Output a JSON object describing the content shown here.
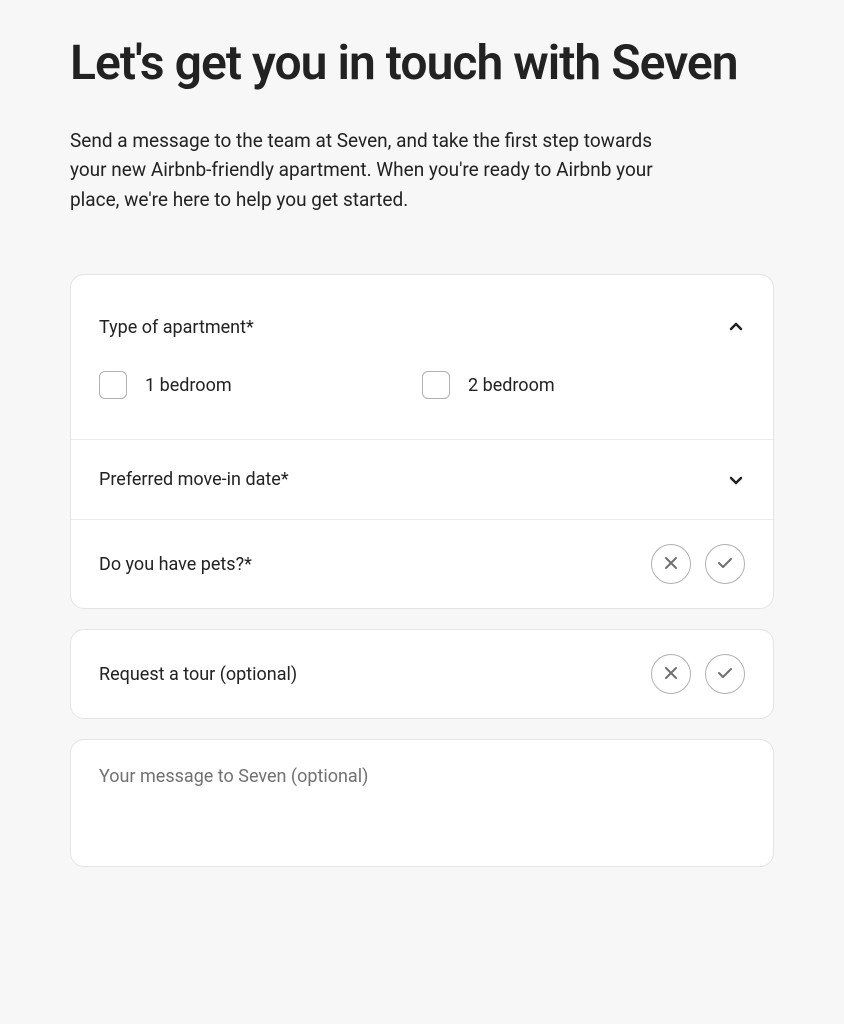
{
  "header": {
    "title": "Let's get you in touch with Seven",
    "intro": "Send a message to the team at Seven, and take the first step towards your new Airbnb-friendly apartment. When you're ready to Airbnb your place, we're here to help you get started."
  },
  "form": {
    "apartment_type": {
      "label": "Type of apartment*",
      "options": [
        "1 bedroom",
        "2 bedroom"
      ]
    },
    "move_in": {
      "label": "Preferred move-in date*"
    },
    "pets": {
      "label": "Do you have pets?*"
    },
    "tour": {
      "label": "Request a tour (optional)"
    },
    "message": {
      "placeholder": "Your message to Seven (optional)"
    }
  }
}
